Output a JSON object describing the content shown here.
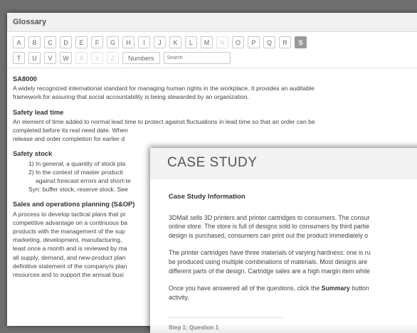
{
  "glossary": {
    "title": "Glossary",
    "letters_row1": [
      "A",
      "B",
      "C",
      "D",
      "E",
      "F",
      "G",
      "H",
      "I",
      "J",
      "K",
      "L",
      "M",
      "N",
      "O",
      "P",
      "Q",
      "R",
      "S"
    ],
    "letters_row2": [
      "T",
      "U",
      "V",
      "W",
      "X",
      "Y",
      "Z"
    ],
    "numbers_label": "Numbers",
    "search_placeholder": "Search",
    "entries": {
      "sa8000": {
        "term": "SA8000",
        "text1": "A widely recognized international standard for managing human rights in the workplace. It provides an auditable",
        "text2": "framework for assuring that social accountability is being stewarded by an organization."
      },
      "lead": {
        "term": "Safety lead time",
        "line1": "An element of time added to normal lead time to protect against fluctuations in lead time so that an order can be",
        "line2": "completed before its real need date. When",
        "line3": "release and order completion for earlier d"
      },
      "stock": {
        "term": "Safety stock",
        "line1": "1) In general, a quantity of stock pla",
        "line2": "2) In the context of master producti",
        "line3": "against forecast errors and short-te",
        "line4": "Syn: buffer stock, reserve stock. See"
      },
      "sop": {
        "term": "Sales and operations planning (S&OP)",
        "line1": "A process to develop tactical plans that pr",
        "line2": "competitive advantage on a continuous ba",
        "line3": "products with the management of the sup",
        "line4": "marketing, development, manufacturing,",
        "line5": "least once a month and is reviewed by ma",
        "line6": "all supply, demand, and new-product plan",
        "line7": "definitive statement of the companyís plan",
        "line8": "resources and to support the annual busi"
      }
    }
  },
  "case_study": {
    "title": "CASE STUDY",
    "subtitle": "Case Study Information",
    "p1_line1": "3DMall sells 3D printers and printer cartridges to consumers. The consur",
    "p1_line2": "online store. The store is full of designs sold to consumers by third partie",
    "p1_line3": "design is purchased, consumers can print out the product immediately o",
    "p2_line1": "The printer cartridges have three materials of varying hardness: one is ru",
    "p2_line2": "be produced using multiple combinations of materials. Most designs are",
    "p2_line3": "different parts of the design. Cartridge sales are a high margin item while",
    "p3_line1_a": "Once you have answered all of the questions, click the ",
    "p3_line1_bold": "Summary",
    "p3_line1_b": " button",
    "p3_line2": "activity.",
    "step_label": "Step 1: Question 1"
  }
}
